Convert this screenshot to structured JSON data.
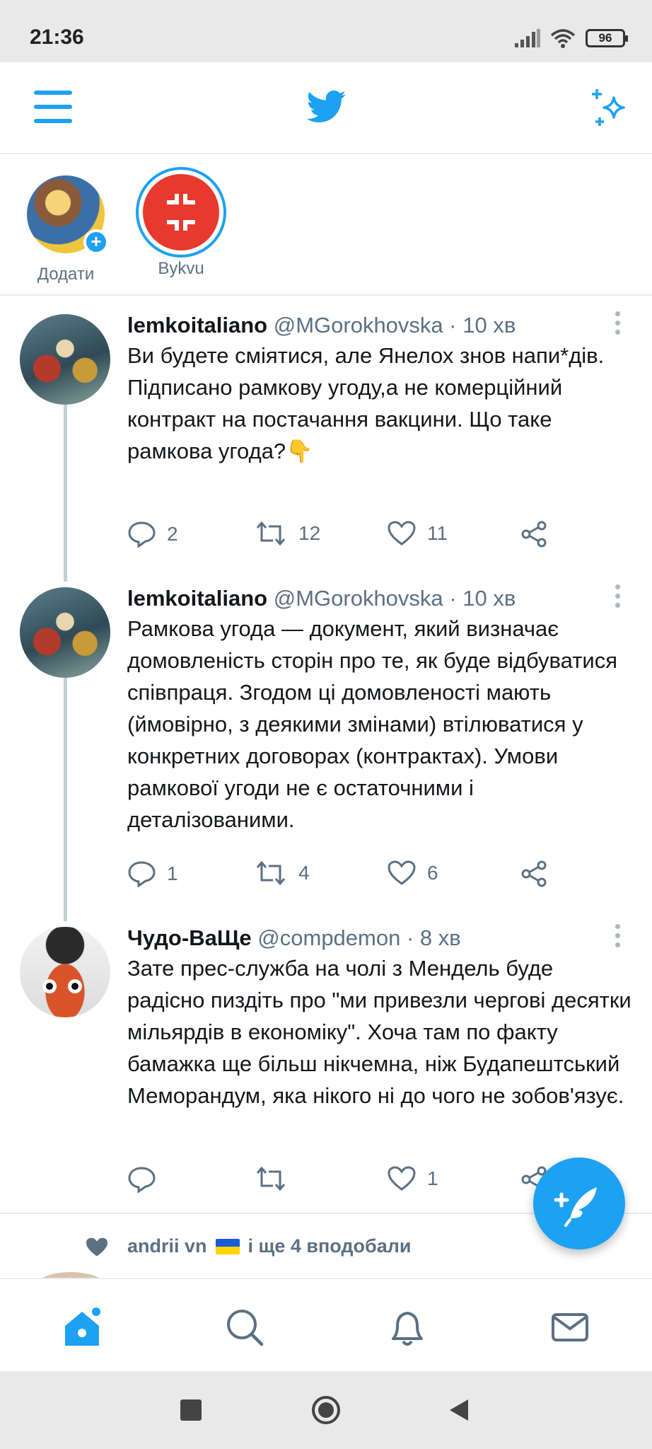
{
  "status_bar": {
    "time": "21:36",
    "battery": "96"
  },
  "fleets": [
    {
      "label": "Додати"
    },
    {
      "label": "Bykvu"
    }
  ],
  "tweets": [
    {
      "name": "lemkoitaliano",
      "handle": "@MGorokhovska",
      "time": "· 10 хв",
      "text": "Ви будете сміятися, але Янелох знов напи*дів.\nПідписано рамкову угоду,а не комерційний контракт на постачання вакцини. Що таке рамкова угода?👇",
      "replies": "2",
      "retweets": "12",
      "likes": "11"
    },
    {
      "name": "lemkoitaliano",
      "handle": "@MGorokhovska",
      "time": "· 10 хв",
      "text": "Рамкова угода — документ, який визначає домовленість сторін про те, як буде відбуватися співпраця. Згодом ці домовленості мають (ймовірно, з деякими змінами) втілюватися у конкретних договорах (контрактах). Умови рамкової угоди не є остаточними і деталізованими.",
      "replies": "1",
      "retweets": "4",
      "likes": "6"
    },
    {
      "name": "Чудо-ВаЩе",
      "handle": "@compdemon",
      "time": "· 8 хв",
      "text": "Зате прес-служба на чолі з Мендель буде радісно пиздіть про \"ми привезли чергові десятки мільярдів в економіку\". Хоча там по факту бамажка ще більш нікчемна, ніж Будапештський Меморандум, яка нікого ні до чого не зобов'язує.",
      "replies": "",
      "retweets": "",
      "likes": "1"
    }
  ],
  "liked_by": {
    "user": "andrii vn",
    "rest": "і ще 4 вподобали"
  },
  "colors": {
    "accent": "#1da1f2",
    "secondary_text": "#5b7083",
    "divider": "#e6ecf0"
  },
  "icons": {
    "menu": "hamburger-menu-icon",
    "logo": "twitter-bird-icon",
    "sparkle": "sparkle-icon",
    "reply": "reply-icon",
    "retweet": "retweet-icon",
    "like": "heart-icon",
    "share": "share-icon",
    "compose": "compose-feather-icon",
    "nav_home": "home-icon",
    "nav_search": "search-icon",
    "nav_notifications": "bell-icon",
    "nav_messages": "mail-icon"
  }
}
